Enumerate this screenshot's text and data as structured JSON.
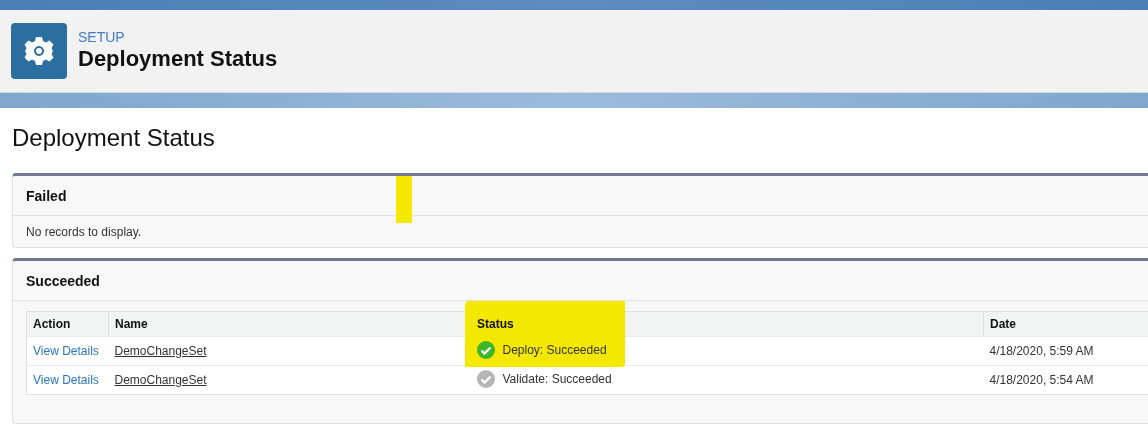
{
  "header": {
    "eyebrow": "SETUP",
    "title": "Deployment Status"
  },
  "page_title": "Deployment Status",
  "sections": [
    {
      "title": "Failed",
      "highlighted": true,
      "empty_text": "No records to display."
    },
    {
      "title": "Succeeded",
      "highlighted": false,
      "table": {
        "columns": [
          "Action",
          "Name",
          "Status",
          "Date"
        ],
        "rows": [
          {
            "action": "View Details",
            "name": "DemoChangeSet",
            "status": "Deploy: Succeeded",
            "kind": "success",
            "highlighted": true,
            "date": "4/18/2020, 5:59 AM"
          },
          {
            "action": "View Details",
            "name": "DemoChangeSet",
            "status": "Validate: Succeeded",
            "kind": "done",
            "highlighted": false,
            "date": "4/18/2020, 5:54 AM"
          }
        ]
      }
    }
  ]
}
